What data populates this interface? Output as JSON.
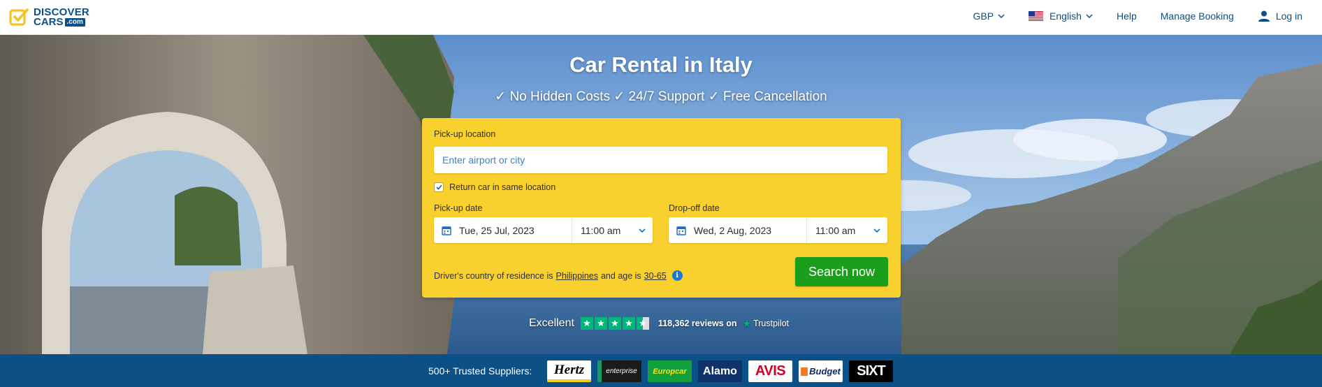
{
  "header": {
    "brand_line1": "DISCOVER",
    "brand_line2": "CARS",
    "brand_suffix": ".com",
    "currency": "GBP",
    "language": "English",
    "help": "Help",
    "manage_booking": "Manage Booking",
    "login": "Log in"
  },
  "hero": {
    "title": "Car Rental in Italy",
    "subtitle": "✓ No Hidden Costs ✓ 24/7 Support ✓ Free Cancellation"
  },
  "search": {
    "pickup_location_label": "Pick-up location",
    "pickup_location_placeholder": "Enter airport or city",
    "return_same_label": "Return car in same location",
    "return_same_checked": true,
    "pickup_date_label": "Pick-up date",
    "pickup_date": "Tue, 25 Jul, 2023",
    "pickup_time": "11:00 am",
    "dropoff_date_label": "Drop-off date",
    "dropoff_date": "Wed, 2 Aug, 2023",
    "dropoff_time": "11:00 am",
    "residence_prefix": "Driver's country of residence is",
    "residence_country": "Philippines",
    "residence_mid": "and age is",
    "age_range": "30-65",
    "search_button": "Search now"
  },
  "trust": {
    "rating_text": "Excellent",
    "stars": 4.5,
    "reviews": "118,362 reviews on",
    "brand": "Trustpilot"
  },
  "suppliers": {
    "label": "500+ Trusted Suppliers:",
    "logos": [
      {
        "name": "Hertz",
        "bg": "#ffffff",
        "fg": "#000000",
        "accent": "#f7d117"
      },
      {
        "name": "enterprise",
        "bg": "#1a1a1a",
        "fg": "#ffffff",
        "accent": "#169b62"
      },
      {
        "name": "Europcar",
        "bg": "#12a03a",
        "fg": "#f5e21c"
      },
      {
        "name": "Alamo",
        "bg": "#10326b",
        "fg": "#ffffff"
      },
      {
        "name": "AVIS",
        "bg": "#ffffff",
        "fg": "#d4002a"
      },
      {
        "name": "Budget",
        "bg": "#ffffff",
        "fg": "#0a2d6b",
        "accent": "#f47c20"
      },
      {
        "name": "SIXT",
        "bg": "#000000",
        "fg": "#ffffff"
      }
    ]
  },
  "colors": {
    "brand_blue": "#0a4f8c",
    "search_yellow": "#f9d12f",
    "search_green": "#1c9e1d",
    "suppliers_bar": "#0d4f87",
    "trustpilot_green": "#00b67a"
  }
}
